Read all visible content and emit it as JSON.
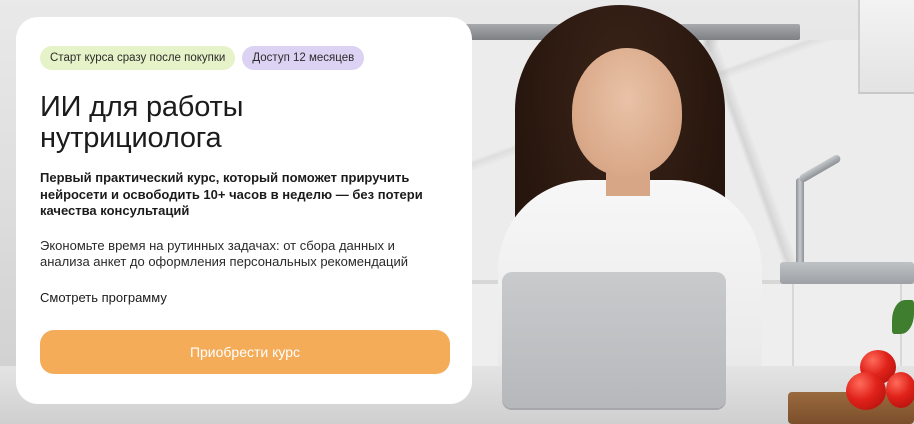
{
  "badges": {
    "start": "Старт курса  сразу после покупки",
    "access": "Доступ 12 месяцев"
  },
  "course": {
    "title": "ИИ для работы нутрициолога",
    "lead": "Первый практический курс, который поможет приручить нейросети и освободить 10+ часов в неделю — без потери качества консультаций",
    "description": "Экономьте время на рутинных задачах: от сбора данных и анализа анкет до оформления персональных рекомендаций"
  },
  "actions": {
    "program_link": "Смотреть программу",
    "buy_button": "Приобрести курс"
  },
  "colors": {
    "badge_green": "#e6f2c7",
    "badge_purple": "#dcd3f4",
    "cta": "#f5ac59"
  },
  "hero_image": {
    "subject": "woman-with-laptop-in-kitchen"
  }
}
